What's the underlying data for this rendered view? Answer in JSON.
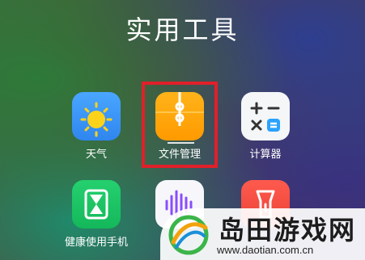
{
  "folder": {
    "title": "实用工具"
  },
  "apps": [
    {
      "label": "天气"
    },
    {
      "label": "文件管理"
    },
    {
      "label": "计算器"
    },
    {
      "label": "健康使用手机"
    },
    {
      "label": ""
    },
    {
      "label": ""
    }
  ],
  "watermark": {
    "name": "岛田游戏网",
    "url": "www.daotian.com.cn"
  },
  "colors": {
    "highlight": "#e0202a"
  }
}
